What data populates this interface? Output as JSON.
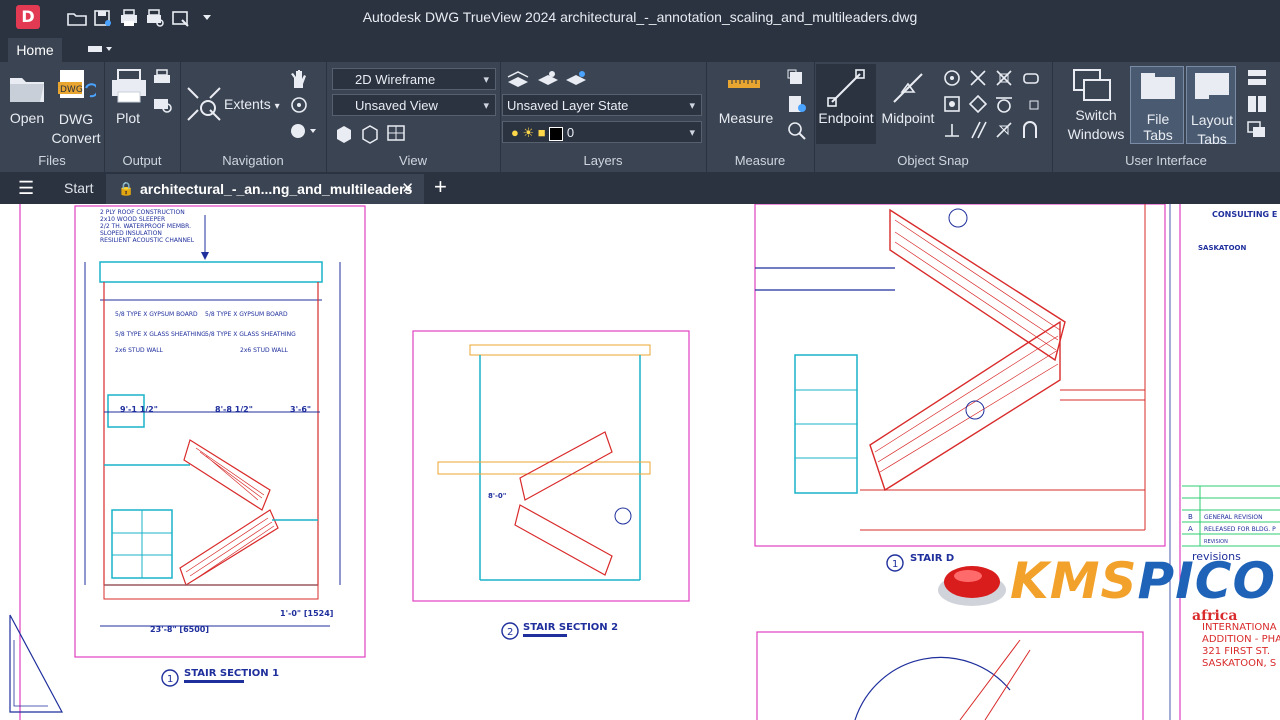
{
  "app": {
    "logo_letter": "D",
    "window_title": "Autodesk DWG TrueView 2024    architectural_-_annotation_scaling_and_multileaders.dwg"
  },
  "quick_access": [
    "open-icon",
    "save-as-icon",
    "plot-icon",
    "print-preview-icon",
    "publish-icon",
    "customize-icon"
  ],
  "ribbon_tabs": {
    "home": "Home"
  },
  "ribbon": {
    "files": {
      "label": "Files",
      "open": "Open",
      "dwg_convert_line1": "DWG",
      "dwg_convert_line2": "Convert"
    },
    "output": {
      "label": "Output",
      "plot": "Plot"
    },
    "navigation": {
      "label": "Navigation",
      "extents": "Extents"
    },
    "view": {
      "label": "View",
      "visual_style": "2D Wireframe",
      "named_view": "Unsaved View"
    },
    "layers": {
      "label": "Layers",
      "layer_state": "Unsaved Layer State",
      "layer_current": "0"
    },
    "measure": {
      "label": "Measure",
      "measure": "Measure"
    },
    "object_snap": {
      "label": "Object Snap",
      "endpoint": "Endpoint",
      "midpoint": "Midpoint"
    },
    "user_interface": {
      "label": "User Interface",
      "switch_windows_line1": "Switch",
      "switch_windows_line2": "Windows",
      "file_tabs_line1": "File Tabs",
      "layout_tabs_line1": "Layout",
      "layout_tabs_line2": "Tabs"
    }
  },
  "doc_tabs": {
    "start": "Start",
    "active": "architectural_-_an...ng_and_multileaders"
  },
  "drawing": {
    "section1": {
      "number": "1",
      "title": "STAIR SECTION 1"
    },
    "section2": {
      "number": "2",
      "title": "STAIR SECTION 2"
    },
    "section3": {
      "number": "1",
      "title": "STAIR D"
    },
    "title_block": {
      "consulting": "CONSULTING E",
      "city": "SASKATOON",
      "rev_b": "GENERAL REVISION",
      "rev_a": "RELEASED FOR BLDG. P",
      "rev_header": "REVISION",
      "revisions": "revisions",
      "client": "africa",
      "project_line1": "INTERNATIONA",
      "project_line2": "ADDITION - PHA",
      "project_line3": "321 FIRST ST.",
      "project_line4": "SASKATOON, S"
    },
    "dims": {
      "d1": "9'-1 1/2\"",
      "d2": "8'-8 1/2\"",
      "d3": "3'-6\"",
      "d4": "8'-0\"",
      "d5": "23'-8\" [6500]",
      "d6": "1'-0\" [1524]"
    }
  },
  "watermark": {
    "part1": "KMS",
    "part2": "PICO"
  },
  "colors": {
    "chrome_dark": "#2b3240",
    "ribbon": "#3b4453",
    "accent_red": "#e23a52",
    "cad_magenta": "#e040c0",
    "cad_red": "#d92b2b",
    "cad_cyan": "#19b3c8",
    "cad_blue": "#1f2f9c"
  }
}
